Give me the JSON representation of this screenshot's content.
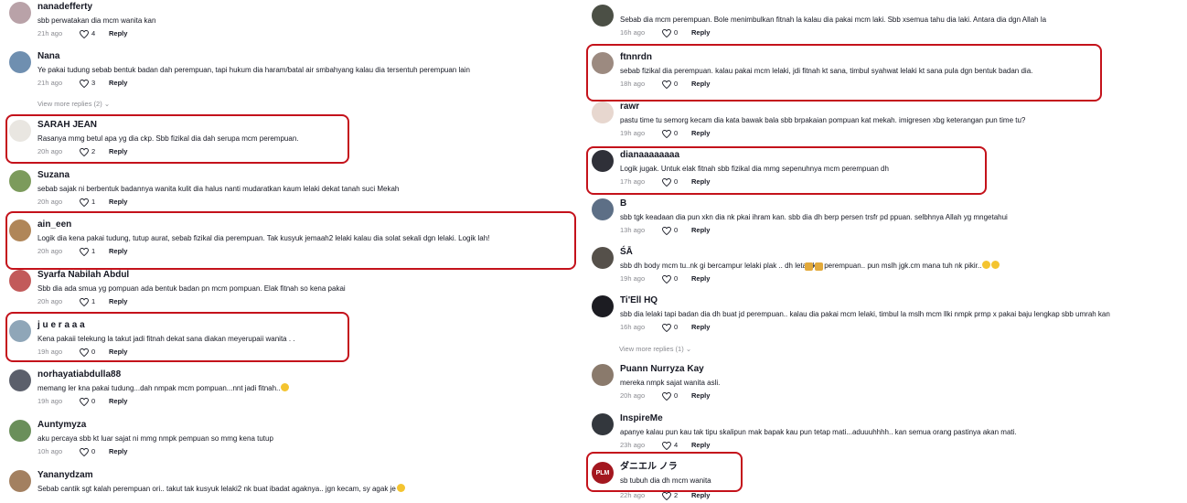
{
  "left_comments": [
    {
      "name": "nanadefferty",
      "text": "sbb perwatakan dia mcm wanita kan",
      "time": "21h ago",
      "likes": "4",
      "reply": "Reply",
      "avatar_color": "#b9a2a8"
    },
    {
      "name": "Nana",
      "text": "Ye pakai tudung sebab bentuk badan dah perempuan, tapi hukum dia haram/batal air smbahyang kalau dia tersentuh perempuan lain",
      "time": "21h ago",
      "likes": "3",
      "reply": "Reply",
      "avatar_color": "#6f8fb0"
    },
    {
      "name": "SARAH JEAN",
      "text": "Rasanya mmg betul apa yg dia ckp. Sbb fizikal dia dah serupa mcm perempuan.",
      "time": "20h ago",
      "likes": "2",
      "reply": "Reply",
      "avatar_color": "#e9e6e1"
    },
    {
      "name": "Suzana",
      "text": "sebab sajak ni berbentuk badannya wanita kulit dia halus nanti mudaratkan kaum lelaki dekat tanah suci Mekah",
      "time": "20h ago",
      "likes": "1",
      "reply": "Reply",
      "avatar_color": "#7c9b5c"
    },
    {
      "name": "ain_een",
      "text": "Logik dia kena pakai tudung, tutup aurat, sebab fizikal dia perempuan. Tak kusyuk jemaah2 lelaki kalau dia solat sekali dgn lelaki. Logik lah!",
      "time": "20h ago",
      "likes": "1",
      "reply": "Reply",
      "avatar_color": "#b08658"
    },
    {
      "name": "Syarfa Nabilah Abdul",
      "text": "Sbb dia ada smua yg pompuan ada bentuk badan pn mcm pompuan. Elak fitnah so kena pakai",
      "time": "20h ago",
      "likes": "1",
      "reply": "Reply",
      "avatar_color": "#c25a5a"
    },
    {
      "name": "j u e r a a a",
      "text": "Kena pakaii telekung la takut jadi fitnah dekat sana diakan meyerupaii wanita . .",
      "time": "19h ago",
      "likes": "0",
      "reply": "Reply",
      "avatar_color": "#8fa6b8"
    },
    {
      "name": "norhayatiabdulla88",
      "text": "memang ler kna pakai tudung...dah nmpak mcm pompuan...nnt jadi fitnah..",
      "time": "19h ago",
      "likes": "0",
      "reply": "Reply",
      "avatar_color": "#5b5f6b"
    },
    {
      "name": "Auntymyza",
      "text": "aku percaya sbb kt luar sajat ni mmg nmpk pempuan so mmg kena tutup",
      "time": "10h ago",
      "likes": "0",
      "reply": "Reply",
      "avatar_color": "#6a8f5a"
    },
    {
      "name": "Yananydzam",
      "text": "Sebab cantik sgt kalah perempuan ori.. takut tak kusyuk lelaki2 nk buat ibadat agaknya.. jgn kecam, sy agak je",
      "time": "",
      "likes": "",
      "reply": "",
      "avatar_color": "#a38060"
    }
  ],
  "left_more_replies": "View more replies (2)",
  "right_comments": [
    {
      "name": "",
      "text": "Sebab dia mcm perempuan. Bole menimbulkan fitnah la kalau dia pakai mcm laki. Sbb xsemua tahu dia laki. Antara dia dgn Allah la",
      "time": "16h ago",
      "likes": "0",
      "reply": "Reply",
      "avatar_color": "#4b4f45"
    },
    {
      "name": "ftnnrdn",
      "text": "sebab fizikal dia perempuan. kalau pakai mcm lelaki, jdi fitnah kt sana, timbul syahwat lelaki kt sana pula dgn bentuk badan dia.",
      "time": "18h ago",
      "likes": "0",
      "reply": "Reply",
      "avatar_color": "#9c8a80"
    },
    {
      "name": "rawr",
      "text": "pastu time tu semorg kecam dia kata bawak bala sbb brpakaian pompuan kat mekah. imigresen xbg keterangan pun time tu?",
      "time": "19h ago",
      "likes": "0",
      "reply": "Reply",
      "avatar_color": "#e7d7cf"
    },
    {
      "name": "dianaaaaaaaa",
      "text": "Logik jugak. Untuk elak fitnah sbb fizikal dia mmg sepenuhnya mcm perempuan dh",
      "time": "17h ago",
      "likes": "0",
      "reply": "Reply",
      "avatar_color": "#2f3038"
    },
    {
      "name": "B",
      "text": "sbb tgk keadaan dia pun xkn dia nk pkai ihram kan. sbb dia dh berp persen trsfr pd ppuan. selbhnya Allah yg mngetahui",
      "time": "13h ago",
      "likes": "0",
      "reply": "Reply",
      "avatar_color": "#5d6f86"
    },
    {
      "name": "ŚĀ",
      "text": "sbb dh body mcm tu..nk gi bercampur lelaki plak     .. dh letak kat perempuan.. pun mslh jgk.cm mana tuh nk pikir..",
      "time": "19h ago",
      "likes": "0",
      "reply": "Reply",
      "avatar_color": "#55504a"
    },
    {
      "name": "Ti'Ell HQ",
      "text": "sbb dia lelaki tapi badan dia dh buat jd perempuan.. kalau dia pakai mcm lelaki, timbul la mslh mcm llki nmpk prmp x pakai baju lengkap sbb umrah kan",
      "time": "16h ago",
      "likes": "0",
      "reply": "Reply",
      "avatar_color": "#1c1c22"
    },
    {
      "name": "Puann Nurryza Kay",
      "text": "mereka nmpk sajat wanita asli.",
      "time": "20h ago",
      "likes": "0",
      "reply": "Reply",
      "avatar_color": "#8a7a6c"
    },
    {
      "name": "InspireMe",
      "text": "apanye kalau pun kau tak tipu skalipun mak bapak kau pun tetap mati...aduuuhhhh.. kan semua orang pastinya akan mati.",
      "time": "23h ago",
      "likes": "4",
      "reply": "Reply",
      "avatar_color": "#33373d"
    },
    {
      "name": "ダニエル ノラ",
      "text": "sb tubuh dia dh mcm wanita",
      "time": "22h ago",
      "likes": "2",
      "reply": "Reply",
      "avatar_color": "#a3171f",
      "avatar_text": "PLM"
    }
  ],
  "right_more_replies": "View more replies (1)",
  "colors": {
    "highlight": "#c4121b",
    "meta": "#8a8b91",
    "text": "#161823"
  }
}
